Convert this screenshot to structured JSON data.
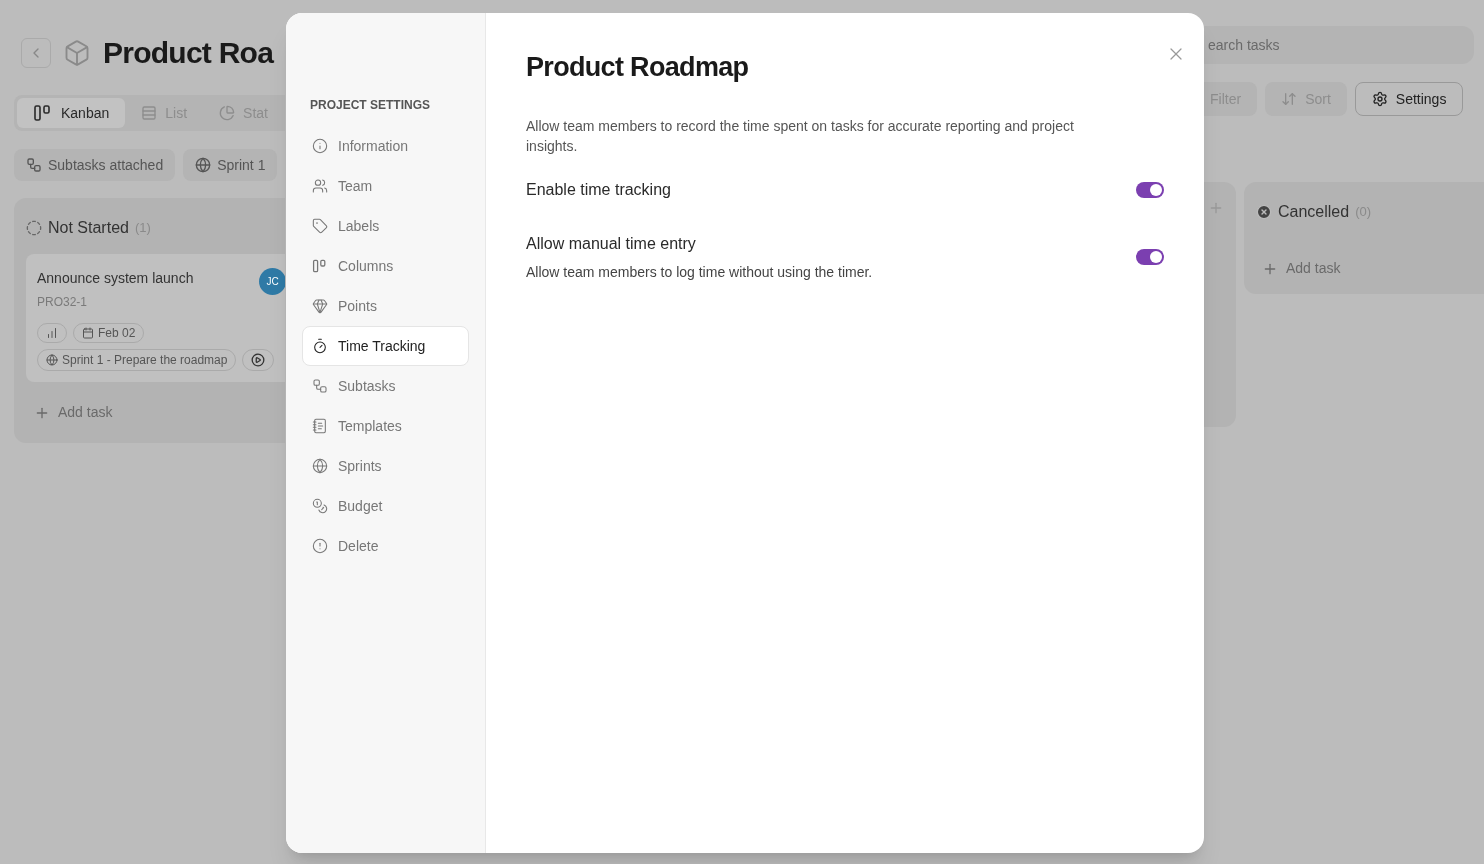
{
  "header": {
    "title": "Product Roa",
    "search": {
      "placeholder": "earch tasks"
    }
  },
  "view_tabs": [
    {
      "label": "Kanban",
      "kind": "kanban",
      "selected": true
    },
    {
      "label": "List",
      "kind": "list",
      "selected": false
    },
    {
      "label": "Stat",
      "kind": "stats",
      "selected": false
    }
  ],
  "toolbar_buttons": [
    {
      "label": "Filter",
      "kind": "filter",
      "selected": false
    },
    {
      "label": "Sort",
      "kind": "sort",
      "selected": false
    },
    {
      "label": "Settings",
      "kind": "settings",
      "selected": true
    }
  ],
  "filter_chips": [
    {
      "label": "Subtasks attached",
      "kind": "subtasks"
    },
    {
      "label": "Sprint 1",
      "kind": "sprint"
    }
  ],
  "columns": [
    {
      "title": "Not Started",
      "count": "(1)",
      "kind": "not-started",
      "add_label": "Add task",
      "cards": [
        {
          "title": "Announce system launch",
          "code": "PRO32-1",
          "date": "Feb 02",
          "sprint": "Sprint 1 - Prepare the roadmap",
          "avatar": "JC"
        }
      ]
    },
    {
      "title": "Cancelled",
      "count": "(0)",
      "kind": "cancelled",
      "add_label": "Add task"
    }
  ],
  "settings_modal": {
    "title": "Product Roadmap",
    "section_title": "PROJECT SETTINGS",
    "nav": [
      {
        "label": "Information",
        "kind": "info",
        "selected": false
      },
      {
        "label": "Team",
        "kind": "team",
        "selected": false
      },
      {
        "label": "Labels",
        "kind": "labels",
        "selected": false
      },
      {
        "label": "Columns",
        "kind": "columns",
        "selected": false
      },
      {
        "label": "Points",
        "kind": "points",
        "selected": false
      },
      {
        "label": "Time Tracking",
        "kind": "time",
        "selected": true
      },
      {
        "label": "Subtasks",
        "kind": "subtasks",
        "selected": false
      },
      {
        "label": "Templates",
        "kind": "templates",
        "selected": false
      },
      {
        "label": "Sprints",
        "kind": "sprints",
        "selected": false
      },
      {
        "label": "Budget",
        "kind": "budget",
        "selected": false
      },
      {
        "label": "Delete",
        "kind": "delete",
        "selected": false
      }
    ],
    "description": "Allow team members to record the time spent on tasks for accurate reporting and project insights.",
    "options": [
      {
        "label": "Enable time tracking",
        "on": true
      },
      {
        "label": "Allow manual time entry",
        "description": "Allow team members to log time without using the timer.",
        "on": true
      }
    ]
  }
}
